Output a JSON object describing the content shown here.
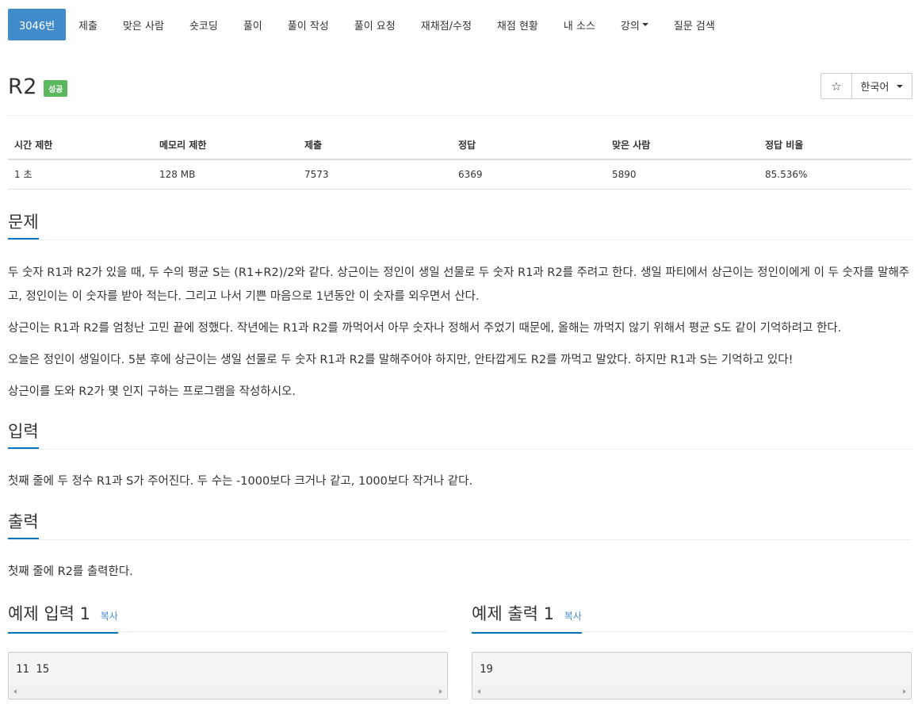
{
  "nav": {
    "tabs": [
      {
        "label": "3046번",
        "active": true
      },
      {
        "label": "제출"
      },
      {
        "label": "맞은 사람"
      },
      {
        "label": "숏코딩"
      },
      {
        "label": "풀이"
      },
      {
        "label": "풀이 작성"
      },
      {
        "label": "풀이 요청"
      },
      {
        "label": "재채점/수정"
      },
      {
        "label": "채점 현황"
      },
      {
        "label": "내 소스"
      },
      {
        "label": "강의",
        "dropdown": true
      },
      {
        "label": "질문 검색"
      }
    ]
  },
  "problem": {
    "title": "R2",
    "status_badge": "성공",
    "star_icon": "☆",
    "language": "한국어"
  },
  "stats": {
    "headers": [
      "시간 제한",
      "메모리 제한",
      "제출",
      "정답",
      "맞은 사람",
      "정답 비율"
    ],
    "values": [
      "1 초",
      "128 MB",
      "7573",
      "6369",
      "5890",
      "85.536%"
    ]
  },
  "sections": {
    "description": {
      "title": "문제",
      "paragraphs": [
        "두 숫자 R1과 R2가 있을 때, 두 수의 평균 S는 (R1+R2)/2와 같다. 상근이는 정인이 생일 선물로 두 숫자 R1과 R2를 주려고 한다. 생일 파티에서 상근이는 정인이에게 이 두 숫자를 말해주고, 정인이는 이 숫자를 받아 적는다. 그리고 나서 기쁜 마음으로 1년동안 이 숫자를 외우면서 산다.",
        "상근이는 R1과 R2를 엄청난 고민 끝에 정했다. 작년에는 R1과 R2를 까먹어서 아무 숫자나 정해서 주었기 때문에, 올해는 까먹지 않기 위해서 평균 S도 같이 기억하려고 한다.",
        "오늘은 정인이 생일이다. 5분 후에 상근이는 생일 선물로 두 숫자 R1과 R2를 말해주어야 하지만, 안타깝게도 R2를 까먹고 말았다. 하지만 R1과 S는 기억하고 있다!",
        "상근이를 도와 R2가 몇 인지 구하는 프로그램을 작성하시오."
      ]
    },
    "input": {
      "title": "입력",
      "text": "첫째 줄에 두 정수 R1과 S가 주어진다. 두 수는 -1000보다 크거나 같고, 1000보다 작거나 같다."
    },
    "output": {
      "title": "출력",
      "text": "첫째 줄에 R2를 출력한다."
    },
    "sample_input": {
      "title": "예제 입력 1",
      "copy": "복사",
      "data": "11 15"
    },
    "sample_output": {
      "title": "예제 출력 1",
      "copy": "복사",
      "data": "19"
    }
  }
}
